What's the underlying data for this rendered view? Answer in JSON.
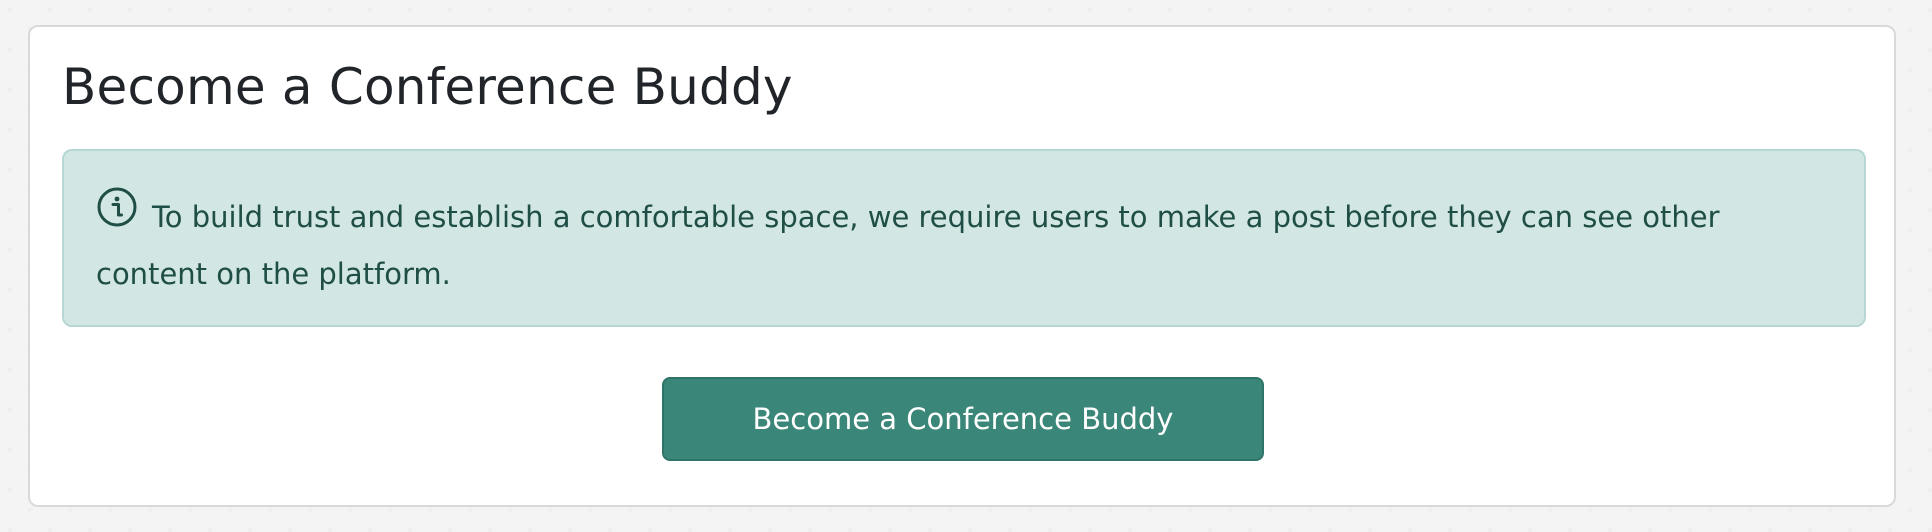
{
  "page": {
    "title": "Become a Conference Buddy"
  },
  "alert": {
    "icon": "info-circle-icon",
    "text": "To build trust and establish a comfortable space, we require users to make a post before they can see other content on the platform.",
    "background_color": "#d2e6e4",
    "text_color": "#1f4e46"
  },
  "actions": {
    "primary_label": "Become a Conference Buddy",
    "primary_color": "#3a8678"
  }
}
